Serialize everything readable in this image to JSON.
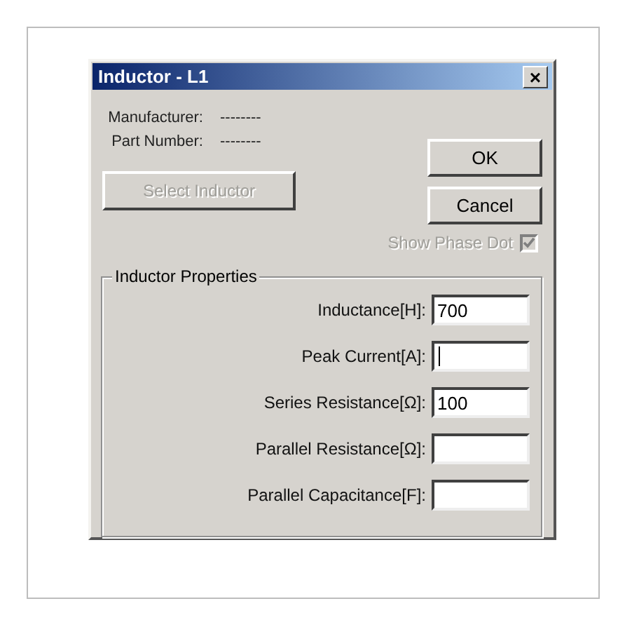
{
  "window": {
    "title": "Inductor - L1",
    "close": "×"
  },
  "info": [
    {
      "label": "Manufacturer:",
      "value": "--------"
    },
    {
      "label": "Part Number:",
      "value": "--------"
    }
  ],
  "select_button": {
    "label": "Select Inductor",
    "disabled": true
  },
  "buttons": [
    "OK",
    "Cancel"
  ],
  "show_phase_dot": {
    "label": "Show Phase Dot",
    "checked": true,
    "disabled": true
  },
  "group": {
    "title": "Inductor Properties",
    "fields": [
      {
        "label": "Inductance[H]:",
        "value": "700",
        "focused": false
      },
      {
        "label": "Peak Current[A]:",
        "focused": true
      },
      {
        "label": "Series Resistance[Ω]:",
        "value": "100",
        "focused": false
      },
      {
        "label": "Parallel Resistance[Ω]:",
        "focused": false
      },
      {
        "label": "Parallel Capacitance[F]:",
        "focused": false
      }
    ]
  }
}
